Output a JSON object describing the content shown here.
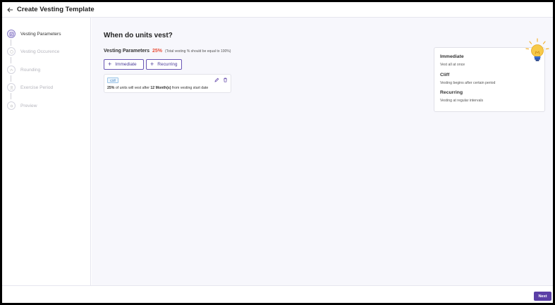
{
  "header": {
    "title": "Create Vesting Template"
  },
  "sidebar": {
    "steps": [
      {
        "label": "Vesting Parameters"
      },
      {
        "label": "Vesting Occurence"
      },
      {
        "label": "Rounding"
      },
      {
        "label": "Exercise Period"
      },
      {
        "label": "Preview"
      }
    ]
  },
  "main": {
    "title": "When do units vest?",
    "params_label": "Vesting Parameters",
    "params_percent": "25%",
    "params_note": "(Total vesting % should be equal to 100%)",
    "add_immediate_label": "Immediate",
    "add_recurring_label": "Recurring",
    "card": {
      "tag": "Cliff",
      "percent": "25%",
      "text_1": " of units will vest after ",
      "period": "12 Month(s)",
      "text_2": " from vesting start date"
    }
  },
  "info": {
    "items": [
      {
        "title": "Immediate",
        "desc": "Vest all at once"
      },
      {
        "title": "Cliff",
        "desc": "Vesting begins after certain period"
      },
      {
        "title": "Recurring",
        "desc": "Vesting at regular intervals"
      }
    ]
  },
  "footer": {
    "next_label": "Next"
  },
  "colors": {
    "accent": "#5b3fa6",
    "percent": "#e8503a",
    "tag": "#3b7fc0"
  }
}
